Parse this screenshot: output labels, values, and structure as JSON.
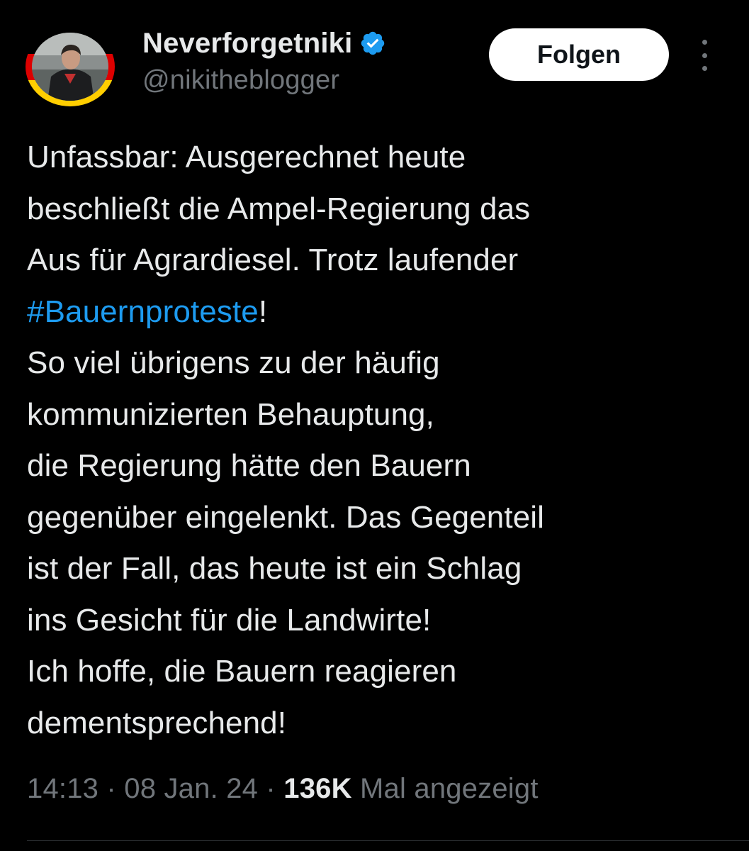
{
  "user": {
    "display_name": "Neverforgetniki",
    "handle": "@nikitheblogger",
    "verified": true,
    "verified_color": "#1d9bf0",
    "avatar_ring_colors": [
      "#000000",
      "#dd0000",
      "#ffce00"
    ]
  },
  "actions": {
    "follow_label": "Folgen",
    "more_icon": "more-vertical-icon"
  },
  "tweet": {
    "lines": [
      "Unfassbar: Ausgerechnet heute",
      "beschließt die Ampel-Regierung das",
      "Aus für Agrardiesel. Trotz laufender",
      "So viel übrigens zu der häufig",
      "kommunizierten Behauptung,",
      "die Regierung hätte den Bauern",
      "gegenüber eingelenkt. Das Gegenteil",
      "ist der Fall, das heute ist ein Schlag",
      "ins Gesicht für die Landwirte!",
      "Ich hoffe, die Bauern reagieren",
      "dementsprechend!"
    ],
    "hashtag": "#Bauernproteste",
    "hashtag_suffix": "!",
    "hashtag_color": "#1d9bf0"
  },
  "meta": {
    "time": "14:13",
    "separator": " · ",
    "date": "08 Jan. 24",
    "views_count": "136K",
    "views_label": " Mal angezeigt"
  }
}
